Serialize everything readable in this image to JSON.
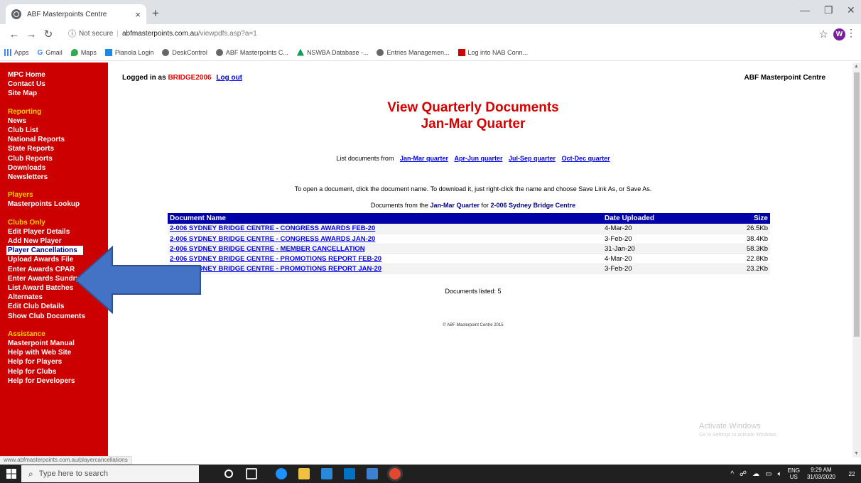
{
  "browser": {
    "tab_title": "ABF Masterpoints Centre",
    "tab_close": "×",
    "new_tab": "+",
    "not_secure": "Not secure",
    "host": "abfmasterpoints.com.au",
    "path": "/viewpdfs.asp?a=1",
    "bookmarks": [
      "Apps",
      "Gmail",
      "Maps",
      "Pianola Login",
      "DeskControl",
      "ABF Masterpoints C...",
      "NSWBA Database -...",
      "Entries Managemen...",
      "Log into NAB Conn..."
    ]
  },
  "sidebar": {
    "group1": [
      "MPC Home",
      "Contact Us",
      "Site Map"
    ],
    "reporting": {
      "heading": "Reporting",
      "items": [
        "News",
        "Club List",
        "National Reports",
        "State Reports",
        "Club Reports",
        "Downloads",
        "Newsletters"
      ]
    },
    "players": {
      "heading": "Players",
      "items": [
        "Masterpoints Lookup"
      ]
    },
    "clubs": {
      "heading": "Clubs Only",
      "items": [
        "Edit Player Details",
        "Add New Player",
        "Player Cancellations",
        "Upload Awards File",
        "Enter Awards CPAR",
        "Enter Awards Sundry",
        "List Award Batches",
        "Alternates",
        "Edit Club Details",
        "Show Club Documents"
      ]
    },
    "assistance": {
      "heading": "Assistance",
      "items": [
        "Masterpoint Manual",
        "Help with Web Site",
        "Help for Players",
        "Help for Clubs",
        "Help for Developers"
      ]
    }
  },
  "header": {
    "logged_in_as": "Logged in as",
    "username": "BRIDGE2006",
    "logout": "Log out",
    "brand": "ABF Masterpoint Centre"
  },
  "page": {
    "title": "View Quarterly Documents",
    "subtitle": "Jan-Mar Quarter",
    "list_from_label": "List documents from",
    "quarters": [
      "Jan-Mar quarter",
      "Apr-Jun quarter",
      "Jul-Sep quarter",
      "Oct-Dec quarter"
    ],
    "instructions": "To open a document, click the document name. To download it, just right-click the name and choose Save Link As, or Save As.",
    "docs_from_prefix": "Documents from the",
    "docs_from_quarter": "Jan-Mar Quarter",
    "docs_from_for": "for",
    "docs_from_club": "2-006 Sydney Bridge Centre",
    "table": {
      "headers": [
        "Document Name",
        "Date Uploaded",
        "Size"
      ],
      "rows": [
        [
          "2-006 SYDNEY BRIDGE CENTRE - CONGRESS AWARDS FEB-20",
          "4-Mar-20",
          "26.5Kb"
        ],
        [
          "2-006 SYDNEY BRIDGE CENTRE - CONGRESS AWARDS JAN-20",
          "3-Feb-20",
          "38.4Kb"
        ],
        [
          "2-006 SYDNEY BRIDGE CENTRE - MEMBER CANCELLATION",
          "31-Jan-20",
          "58.3Kb"
        ],
        [
          "2-006 SYDNEY BRIDGE CENTRE - PROMOTIONS REPORT FEB-20",
          "4-Mar-20",
          "22.8Kb"
        ],
        [
          "2-006 SYDNEY BRIDGE CENTRE - PROMOTIONS REPORT JAN-20",
          "3-Feb-20",
          "23.2Kb"
        ]
      ]
    },
    "documents_listed": "Documents listed: 5",
    "copyright": "© ABF Masterpoint Centre 2015",
    "watermark_title": "Activate Windows",
    "watermark_sub": "Go to Settings to activate Windows."
  },
  "status_url": "www.abfmasterpoints.com.au/playercancellations",
  "taskbar": {
    "search_placeholder": "Type here to search",
    "lang_top": "ENG",
    "lang_bottom": "US",
    "time": "9:29 AM",
    "date": "31/03/2020",
    "notification_count": "22"
  },
  "colors": {
    "sidebar_bg": "#cc0000",
    "sidebar_heading": "#ffcc00",
    "title_red": "#d40000",
    "table_header": "#0000a8",
    "link_blue": "#0000ee",
    "arrow_blue": "#4472c4"
  }
}
